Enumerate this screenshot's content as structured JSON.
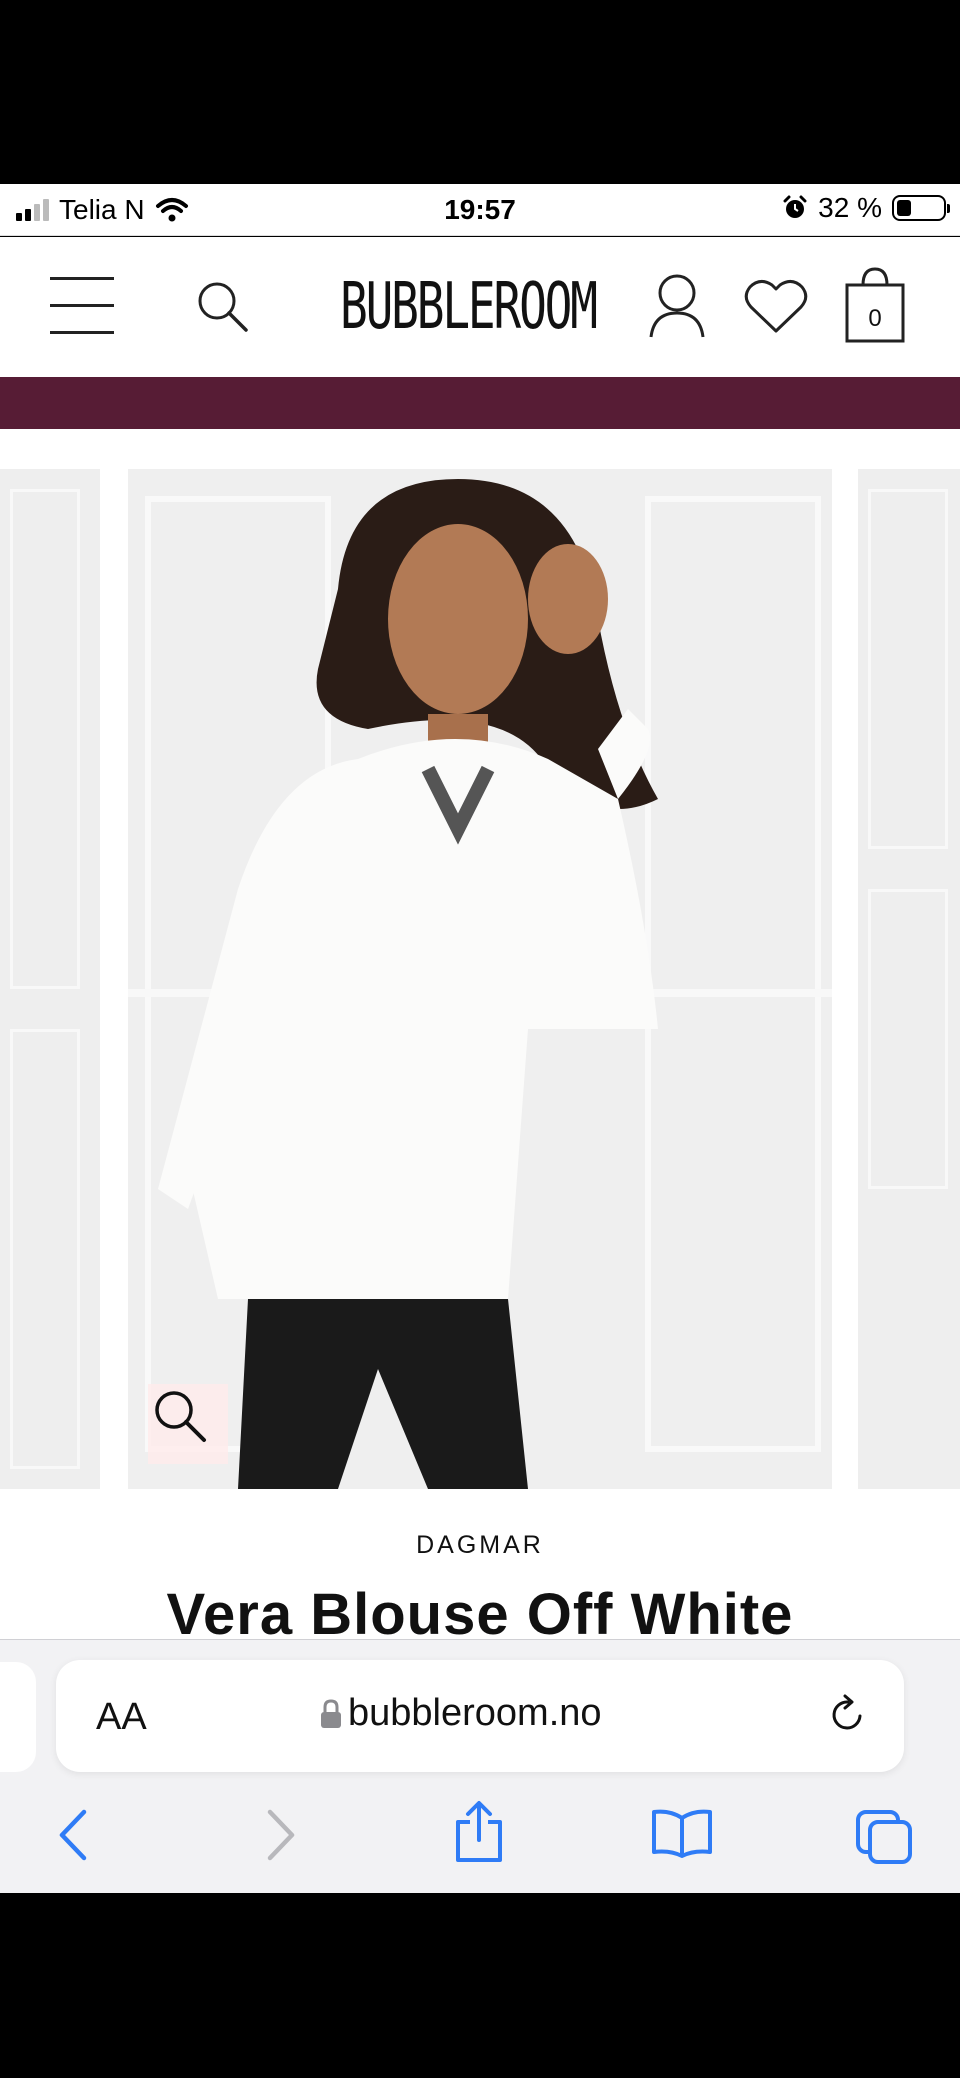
{
  "status_bar": {
    "carrier": "Telia N",
    "time": "19:57",
    "battery_percent": "32 %",
    "battery_level": 0.32
  },
  "header": {
    "logo_text": "BUBBLEROOM",
    "cart_count": "0"
  },
  "colors": {
    "promo_bar": "#571c35",
    "accent_blue": "#2f7cf6"
  },
  "product": {
    "brand": "DAGMAR",
    "title": "Vera Blouse Off White"
  },
  "browser": {
    "text_size_label": "AA",
    "url": "bubbleroom.no"
  },
  "icons": {
    "menu": "hamburger-icon",
    "search": "search-icon",
    "account": "user-icon",
    "wishlist": "heart-icon",
    "cart": "bag-icon",
    "zoom": "zoom-icon",
    "lock": "lock-icon",
    "reload": "reload-icon",
    "back": "chevron-left-icon",
    "forward": "chevron-right-icon",
    "share": "share-icon",
    "bookmarks": "book-icon",
    "tabs": "tabs-icon"
  }
}
